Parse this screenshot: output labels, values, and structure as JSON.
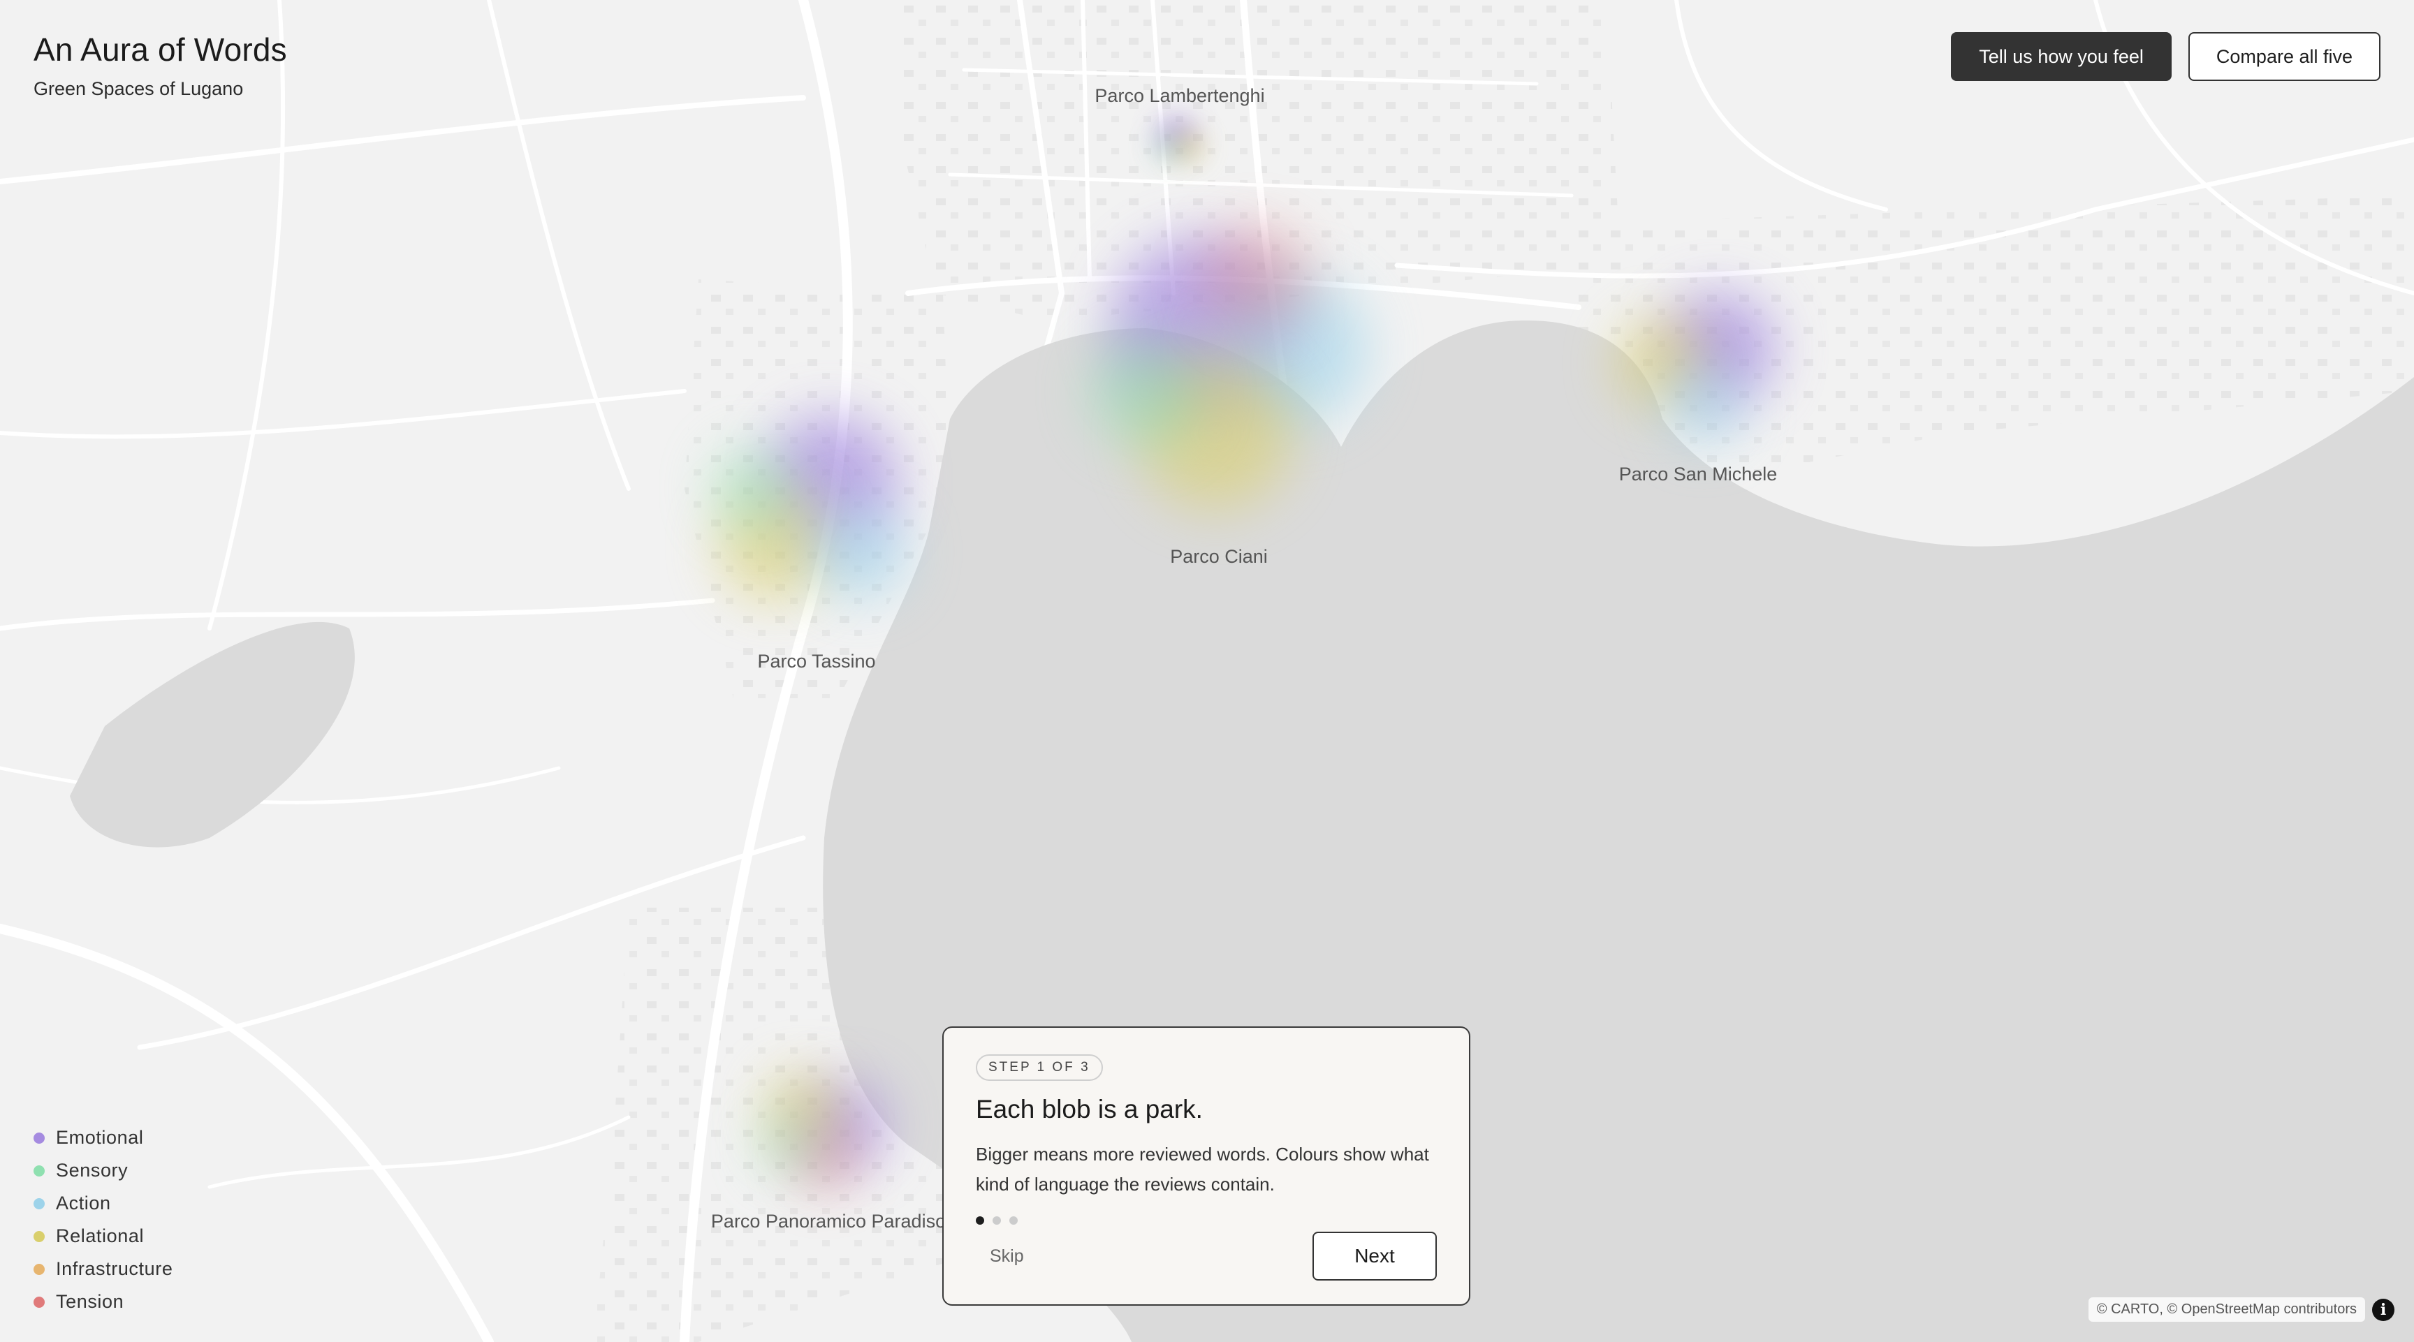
{
  "app": {
    "title": "An Aura of Words",
    "subtitle": "Green Spaces of Lugano"
  },
  "actions": {
    "primary_label": "Tell us how you feel",
    "secondary_label": "Compare all five"
  },
  "parks": [
    {
      "name": "Parco Lambertenghi"
    },
    {
      "name": "Parco Ciani"
    },
    {
      "name": "Parco San Michele"
    },
    {
      "name": "Parco Tassino"
    },
    {
      "name": "Parco Panoramico Paradiso"
    }
  ],
  "legend": [
    {
      "label": "Emotional",
      "color": "#a58be0"
    },
    {
      "label": "Sensory",
      "color": "#8fe0b0"
    },
    {
      "label": "Action",
      "color": "#9dd3ea"
    },
    {
      "label": "Relational",
      "color": "#d9cf6c"
    },
    {
      "label": "Infrastructure",
      "color": "#e7b56f"
    },
    {
      "label": "Tension",
      "color": "#e07a7a"
    }
  ],
  "tour": {
    "step": "STEP 1 OF 3",
    "title": "Each blob is a park.",
    "text": "Bigger means more reviewed words. Colours show what kind of language the reviews contain.",
    "total_steps": 3,
    "current_step": 1,
    "skip_label": "Skip",
    "next_label": "Next"
  },
  "attribution": "© CARTO, © OpenStreetMap contributors",
  "info_icon": "info-icon",
  "colors": {
    "lake": "#dadada",
    "land": "#f2f2f2",
    "road": "#ffffff",
    "dark_button": "#333333"
  }
}
